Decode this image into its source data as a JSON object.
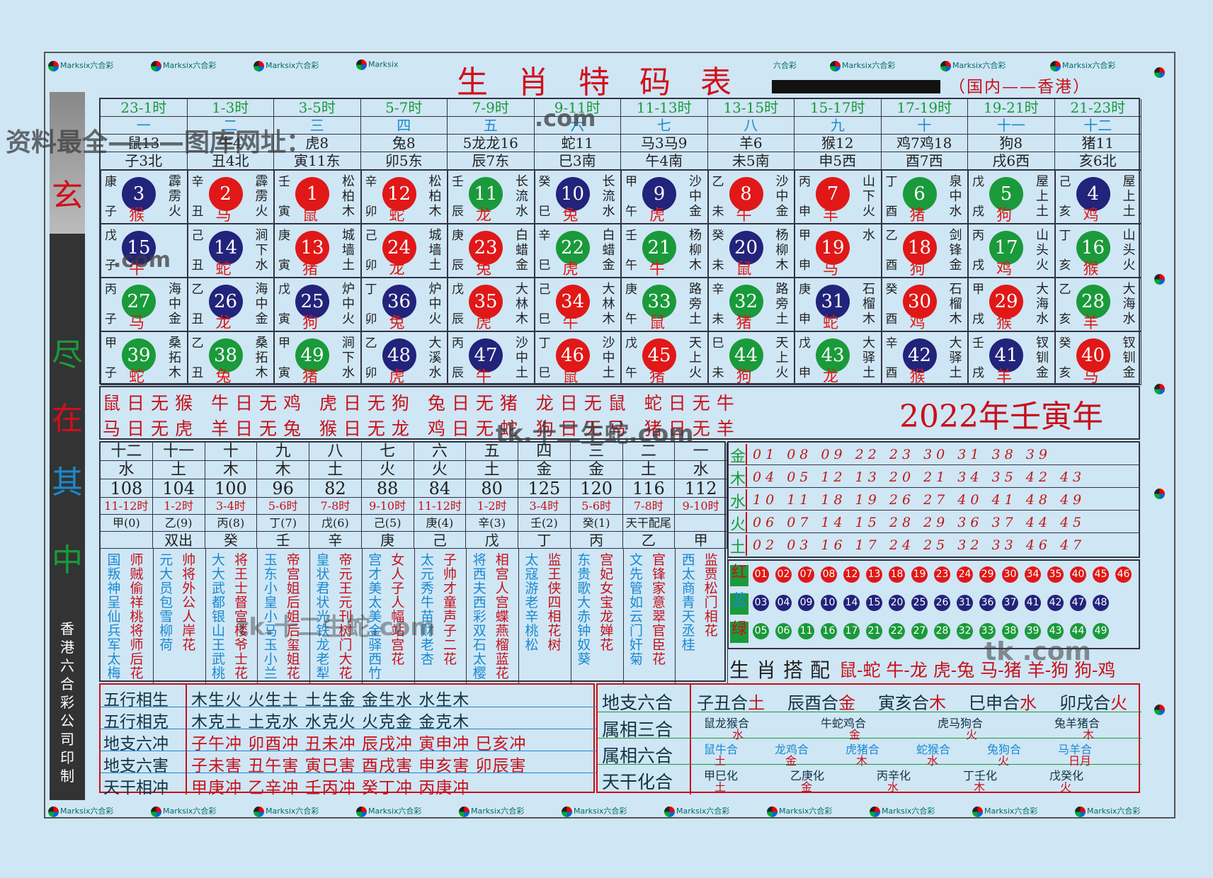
{
  "title": "生肖特码表",
  "region": "（国内——香港）",
  "brand": "Marksix六合彩",
  "brand_short": "Marksix",
  "brand_cn": "六合彩",
  "watermark_top": "资料最全———图库网址：",
  "watermark_url": ".com",
  "watermark_mid": "tk.十二生蛇.com",
  "watermark_tk": "tk.",
  "watermark_right": "tk .com",
  "side_chars": [
    "玄",
    "尽",
    "在",
    "其",
    "中"
  ],
  "side_print": "香港六合彩公司印制",
  "times": [
    "23-1时",
    "1-3时",
    "3-5时",
    "5-7时",
    "7-9时",
    "9-11时",
    "11-13时",
    "13-15时",
    "15-17时",
    "17-19时",
    "19-21时",
    "21-23时"
  ],
  "months": [
    "一",
    "二",
    "三",
    "四",
    "五",
    "六",
    "七",
    "八",
    "九",
    "十",
    "十一",
    "十二"
  ],
  "animals": [
    "鼠13",
    "牛4",
    "虎8",
    "兔8",
    "5龙龙16",
    "蛇11",
    "马3马9",
    "羊6",
    "猴12",
    "鸡7鸡18",
    "狗8",
    "猪11"
  ],
  "branches": [
    "子3北",
    "丑4北",
    "寅11东",
    "卯5东",
    "辰7东",
    "巳3南",
    "午4南",
    "未5南",
    "申5西",
    "酉7西",
    "戌6西",
    "亥6北"
  ],
  "grid": [
    [
      {
        "n": "3",
        "c": "blue",
        "s": "康",
        "b": "子",
        "z": "猴",
        "e": "霹雳火"
      },
      {
        "n": "2",
        "c": "red",
        "s": "辛",
        "b": "丑",
        "z": "马",
        "e": "霹雳火"
      },
      {
        "n": "1",
        "c": "red",
        "s": "壬",
        "b": "寅",
        "z": "鼠",
        "e": "松柏木"
      },
      {
        "n": "12",
        "c": "red",
        "s": "辛",
        "b": "卯",
        "z": "蛇",
        "e": "松柏木"
      },
      {
        "n": "11",
        "c": "green",
        "s": "壬",
        "b": "辰",
        "z": "龙",
        "e": "长流水"
      },
      {
        "n": "10",
        "c": "blue",
        "s": "癸",
        "b": "巳",
        "z": "兔",
        "e": "长流水"
      },
      {
        "n": "9",
        "c": "blue",
        "s": "甲",
        "b": "午",
        "z": "虎",
        "e": "沙中金"
      },
      {
        "n": "8",
        "c": "red",
        "s": "乙",
        "b": "未",
        "z": "牛",
        "e": "沙中金"
      },
      {
        "n": "7",
        "c": "red",
        "s": "丙",
        "b": "申",
        "z": "羊",
        "e": "山下火"
      },
      {
        "n": "6",
        "c": "green",
        "s": "丁",
        "b": "酉",
        "z": "猪",
        "e": "泉中水"
      },
      {
        "n": "5",
        "c": "green",
        "s": "戊",
        "b": "戌",
        "z": "狗",
        "e": "屋上土"
      },
      {
        "n": "4",
        "c": "blue",
        "s": "己",
        "b": "亥",
        "z": "鸡",
        "e": "屋上土"
      }
    ],
    [
      {
        "n": "15",
        "c": "blue",
        "s": "戊",
        "b": "子",
        "z": "牛",
        "e": ""
      },
      {
        "n": "14",
        "c": "blue",
        "s": "己",
        "b": "丑",
        "z": "蛇",
        "e": "涧下水"
      },
      {
        "n": "13",
        "c": "red",
        "s": "庚",
        "b": "寅",
        "z": "猪",
        "e": "城墙土"
      },
      {
        "n": "24",
        "c": "red",
        "s": "己",
        "b": "卯",
        "z": "龙",
        "e": "城墙土"
      },
      {
        "n": "23",
        "c": "red",
        "s": "庚",
        "b": "辰",
        "z": "兔",
        "e": "白蜡金"
      },
      {
        "n": "22",
        "c": "green",
        "s": "辛",
        "b": "巳",
        "z": "虎",
        "e": "白蜡金"
      },
      {
        "n": "21",
        "c": "green",
        "s": "壬",
        "b": "午",
        "z": "牛",
        "e": "杨柳木"
      },
      {
        "n": "20",
        "c": "blue",
        "s": "癸",
        "b": "未",
        "z": "鼠",
        "e": "杨柳木"
      },
      {
        "n": "19",
        "c": "red",
        "s": "甲",
        "b": "申",
        "z": "马",
        "e": "水"
      },
      {
        "n": "18",
        "c": "red",
        "s": "乙",
        "b": "酉",
        "z": "狗",
        "e": "剑锋金"
      },
      {
        "n": "17",
        "c": "green",
        "s": "丙",
        "b": "戌",
        "z": "鸡",
        "e": "山头火"
      },
      {
        "n": "16",
        "c": "green",
        "s": "丁",
        "b": "亥",
        "z": "猴",
        "e": "山头火"
      }
    ],
    [
      {
        "n": "27",
        "c": "green",
        "s": "丙",
        "b": "子",
        "z": "马",
        "e": "海中金"
      },
      {
        "n": "26",
        "c": "blue",
        "s": "乙",
        "b": "丑",
        "z": "龙",
        "e": "海中金"
      },
      {
        "n": "25",
        "c": "blue",
        "s": "戊",
        "b": "寅",
        "z": "狗",
        "e": "炉中火"
      },
      {
        "n": "36",
        "c": "blue",
        "s": "丁",
        "b": "卯",
        "z": "兔",
        "e": "炉中火"
      },
      {
        "n": "35",
        "c": "red",
        "s": "戊",
        "b": "辰",
        "z": "虎",
        "e": "大林木"
      },
      {
        "n": "34",
        "c": "red",
        "s": "己",
        "b": "巳",
        "z": "牛",
        "e": "大林木"
      },
      {
        "n": "33",
        "c": "green",
        "s": "庚",
        "b": "午",
        "z": "鼠",
        "e": "路旁土"
      },
      {
        "n": "32",
        "c": "green",
        "s": "辛",
        "b": "未",
        "z": "猪",
        "e": "路旁土"
      },
      {
        "n": "31",
        "c": "blue",
        "s": "庚",
        "b": "申",
        "z": "蛇",
        "e": "石榴木"
      },
      {
        "n": "30",
        "c": "red",
        "s": "癸",
        "b": "酉",
        "z": "鸡",
        "e": "石榴木"
      },
      {
        "n": "29",
        "c": "red",
        "s": "甲",
        "b": "戌",
        "z": "猴",
        "e": "大海水"
      },
      {
        "n": "28",
        "c": "green",
        "s": "乙",
        "b": "亥",
        "z": "羊",
        "e": "大海水"
      }
    ],
    [
      {
        "n": "39",
        "c": "green",
        "s": "甲",
        "b": "子",
        "z": "蛇",
        "e": "桑拓木"
      },
      {
        "n": "38",
        "c": "green",
        "s": "乙",
        "b": "丑",
        "z": "兔",
        "e": "桑拓木"
      },
      {
        "n": "49",
        "c": "green",
        "s": "甲",
        "b": "寅",
        "z": "猪",
        "e": "涧下水"
      },
      {
        "n": "48",
        "c": "blue",
        "s": "乙",
        "b": "卯",
        "z": "虎",
        "e": "大溪水"
      },
      {
        "n": "47",
        "c": "blue",
        "s": "丙",
        "b": "辰",
        "z": "牛",
        "e": "沙中土"
      },
      {
        "n": "46",
        "c": "red",
        "s": "丁",
        "b": "巳",
        "z": "鼠",
        "e": "沙中土"
      },
      {
        "n": "45",
        "c": "red",
        "s": "戊",
        "b": "午",
        "z": "猪",
        "e": "天上火"
      },
      {
        "n": "44",
        "c": "green",
        "s": "巳",
        "b": "未",
        "z": "狗",
        "e": "天上火"
      },
      {
        "n": "43",
        "c": "green",
        "s": "戊",
        "b": "申",
        "z": "龙",
        "e": "大驿土"
      },
      {
        "n": "42",
        "c": "blue",
        "s": "辛",
        "b": "酉",
        "z": "猴",
        "e": "大驿土"
      },
      {
        "n": "41",
        "c": "blue",
        "s": "壬",
        "b": "戌",
        "z": "羊",
        "e": "钗钏金"
      },
      {
        "n": "40",
        "c": "red",
        "s": "癸",
        "b": "亥",
        "z": "马",
        "e": "钗钏金"
      }
    ]
  ],
  "day_rows": [
    "鼠日无猴 牛日无鸡 虎日无狗 兔日无猪 龙日无鼠 蛇日无牛",
    "马日无虎 羊日无兔 猴日无龙 鸡日无蛇 狗日无马 猪日无羊"
  ],
  "year": "2022年壬寅年",
  "lower_months": [
    "十二",
    "十一",
    "十",
    "九",
    "八",
    "七",
    "六",
    "五",
    "四",
    "三",
    "二",
    "一"
  ],
  "lower_elements": [
    "水",
    "土",
    "木",
    "木",
    "土",
    "火",
    "火",
    "土",
    "金",
    "金",
    "土",
    "水"
  ],
  "lower_values": [
    "108",
    "104",
    "100",
    "96",
    "82",
    "88",
    "84",
    "80",
    "125",
    "120",
    "116",
    "112"
  ],
  "lower_times": [
    "11-12时",
    "1-2时",
    "3-4时",
    "5-6时",
    "7-8时",
    "9-10时",
    "11-12时",
    "1-2时",
    "3-4时",
    "5-6时",
    "7-8时",
    "9-10时"
  ],
  "lower_stems": [
    "甲(0)",
    "乙(9)",
    "丙(8)",
    "丁(7)",
    "戊(6)",
    "己(5)",
    "庚(4)",
    "辛(3)",
    "壬(2)",
    "癸(1)",
    "天干配尾",
    ""
  ],
  "lower_heads": [
    "",
    "双出",
    "癸",
    "壬",
    "辛",
    "庚",
    "己",
    "戊",
    "丁",
    "丙",
    "乙",
    "甲"
  ],
  "columns_text": [
    [
      "国叛神呈仙兵军太梅",
      "师贼偷祥桃将师后花"
    ],
    [
      "元大员包雪柳荷",
      "帅将外公人岸花"
    ],
    [
      "大大武都银山王武桃",
      "将王士督宫楼爷士花"
    ],
    [
      "玉东小皇小马玉小兰",
      "帝宫姐后姐后玺姐花"
    ],
    [
      "皇状君状光铁龙老犁",
      "帝元王元刊树门大花"
    ],
    [
      "宫才美太美金驿西竹",
      "女人子人幅站宫花"
    ],
    [
      "太元秀牛苗财老杏",
      "子帅才童声子二花"
    ],
    [
      "将西夫西彩双石太樱",
      "相宫人宫蝶燕榴蓝花"
    ],
    [
      "太寇游老辛桃松",
      "监王侠四相花树"
    ],
    [
      "东贵歌大赤钟奴葵",
      "宫妃女宝龙婵花"
    ],
    [
      "文先管如云门奸菊",
      "官锋家意翠官臣花"
    ],
    [
      "西太商青天丞桂",
      "监贾松门相花"
    ]
  ],
  "wx": [
    {
      "k": "金",
      "nums": "01 08 09 22 23 30 31 38 39"
    },
    {
      "k": "木",
      "nums": "04 05 12 13 20 21 34 35 42 43"
    },
    {
      "k": "水",
      "nums": "10 11 18 19 26 27 40 41 48 49"
    },
    {
      "k": "火",
      "nums": "06 07 14 15 28 29 36 37 44 45"
    },
    {
      "k": "土",
      "nums": "02 03 16 17 24 25 32 33 46 47"
    }
  ],
  "wave_labels": [
    "红",
    "蓝",
    "绿"
  ],
  "red_balls": [
    "01",
    "02",
    "07",
    "08",
    "12",
    "13",
    "18",
    "19",
    "23",
    "24",
    "29",
    "30",
    "34",
    "35",
    "40",
    "45",
    "46"
  ],
  "blue_balls": [
    "03",
    "04",
    "09",
    "10",
    "14",
    "15",
    "20",
    "25",
    "26",
    "31",
    "36",
    "37",
    "41",
    "42",
    "47",
    "48"
  ],
  "green_balls": [
    "05",
    "06",
    "11",
    "16",
    "17",
    "21",
    "22",
    "27",
    "28",
    "32",
    "33",
    "38",
    "39",
    "43",
    "44",
    "49"
  ],
  "pairing_label": "生肖搭配",
  "pairing": "鼠-蛇 牛-龙 虎-兔 马-猪 羊-狗 狗-鸡",
  "rel_left": [
    {
      "k": "五行相生",
      "v": "木生火 火生土 土生金 金生水 水生木"
    },
    {
      "k": "五行相克",
      "v": "木克土 土克水 水克火 火克金 金克木"
    },
    {
      "k": "地支六冲",
      "v": "子午冲 卯酉冲 丑未冲 辰戌冲 寅申冲 巳亥冲"
    },
    {
      "k": "地支六害",
      "v": "子未害 丑午害 寅巳害 酉戌害 申亥害 卯辰害"
    },
    {
      "k": "天干相冲",
      "v": "甲庚冲 乙辛冲 壬丙冲 癸丁冲 丙庚冲"
    }
  ],
  "rel_right_labels": [
    "地支六合",
    "属相三合",
    "属相六合",
    "天干化合"
  ],
  "dizhi_liuhe": [
    {
      "p": "子丑合",
      "e": "土"
    },
    {
      "p": "辰酉合",
      "e": "金"
    },
    {
      "p": "寅亥合",
      "e": "木"
    },
    {
      "p": "巳申合",
      "e": "水"
    },
    {
      "p": "卯戌合",
      "e": "火"
    }
  ],
  "sanhe": [
    {
      "p": "鼠龙猴合",
      "e": "水"
    },
    {
      "p": "牛蛇鸡合",
      "e": "金"
    },
    {
      "p": "虎马狗合",
      "e": "火"
    },
    {
      "p": "兔羊猪合",
      "e": "木"
    }
  ],
  "liuhe": [
    {
      "p": "鼠牛合",
      "e": "土"
    },
    {
      "p": "龙鸡合",
      "e": "金"
    },
    {
      "p": "虎猪合",
      "e": "木"
    },
    {
      "p": "蛇猴合",
      "e": "水"
    },
    {
      "p": "兔狗合",
      "e": "火"
    },
    {
      "p": "马羊合",
      "e": "日月"
    }
  ],
  "tiangan": [
    {
      "p": "甲巳化",
      "e": "土"
    },
    {
      "p": "乙庚化",
      "e": "金"
    },
    {
      "p": "丙辛化",
      "e": "水"
    },
    {
      "p": "丁壬化",
      "e": "木"
    },
    {
      "p": "戊癸化",
      "e": "火"
    }
  ],
  "colors": {
    "red": "#e01818",
    "blue": "#22237a",
    "green": "#1a9a3a",
    "title": "#d0101a",
    "bg": "#cfe6f5"
  }
}
